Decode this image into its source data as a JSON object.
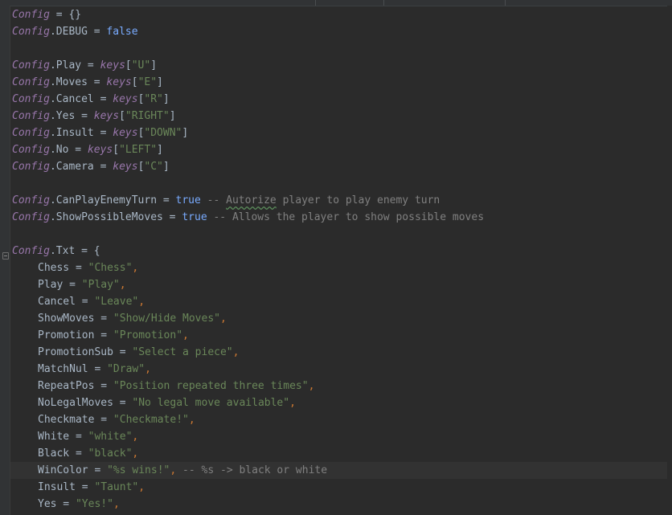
{
  "editor": {
    "top_lines": [
      {
        "obj": "Config",
        "rest": " = {}"
      },
      {
        "obj": "Config",
        "rest": ".DEBUG = ",
        "val": "false"
      }
    ],
    "keys": [
      {
        "obj": "Config",
        "field": ".Play = ",
        "fn": "keys",
        "open": "[",
        "str": "\"U\"",
        "close": "]"
      },
      {
        "obj": "Config",
        "field": ".Moves = ",
        "fn": "keys",
        "open": "[",
        "str": "\"E\"",
        "close": "]"
      },
      {
        "obj": "Config",
        "field": ".Cancel = ",
        "fn": "keys",
        "open": "[",
        "str": "\"R\"",
        "close": "]"
      },
      {
        "obj": "Config",
        "field": ".Yes = ",
        "fn": "keys",
        "open": "[",
        "str": "\"RIGHT\"",
        "close": "]"
      },
      {
        "obj": "Config",
        "field": ".Insult = ",
        "fn": "keys",
        "open": "[",
        "str": "\"DOWN\"",
        "close": "]"
      },
      {
        "obj": "Config",
        "field": ".No = ",
        "fn": "keys",
        "open": "[",
        "str": "\"LEFT\"",
        "close": "]"
      },
      {
        "obj": "Config",
        "field": ".Camera = ",
        "fn": "keys",
        "open": "[",
        "str": "\"C\"",
        "close": "]"
      }
    ],
    "flags": [
      {
        "obj": "Config",
        "field": ".CanPlayEnemyTurn = ",
        "val": "true",
        "cmt_pre": " -- ",
        "cmt_word": "Autorize",
        "cmt_post": " player to play enemy turn"
      },
      {
        "obj": "Config",
        "field": ".ShowPossibleMoves = ",
        "val": "true",
        "cmt_pre": " -- ",
        "cmt_word": "",
        "cmt_post": "Allows the player to show possible moves"
      }
    ],
    "txt_open": {
      "obj": "Config",
      "rest": ".Txt = {"
    },
    "txt": [
      {
        "key": "Chess = ",
        "str": "\"Chess\"",
        "tail": ","
      },
      {
        "key": "Play = ",
        "str": "\"Play\"",
        "tail": ","
      },
      {
        "key": "Cancel = ",
        "str": "\"Leave\"",
        "tail": ","
      },
      {
        "key": "ShowMoves = ",
        "str": "\"Show/Hide Moves\"",
        "tail": ","
      },
      {
        "key": "Promotion = ",
        "str": "\"Promotion\"",
        "tail": ","
      },
      {
        "key": "PromotionSub = ",
        "str": "\"Select a piece\"",
        "tail": ","
      },
      {
        "key": "MatchNul = ",
        "str": "\"Draw\"",
        "tail": ","
      },
      {
        "key": "RepeatPos = ",
        "str": "\"Position repeated three times\"",
        "tail": ","
      },
      {
        "key": "NoLegalMoves = ",
        "str": "\"No legal move available\"",
        "tail": ","
      },
      {
        "key": "Checkmate = ",
        "str": "\"Checkmate!\"",
        "tail": ","
      },
      {
        "key": "White = ",
        "str": "\"white\"",
        "tail": ","
      },
      {
        "key": "Black = ",
        "str": "\"black\"",
        "tail": ","
      },
      {
        "key": "WinColor = ",
        "str": "\"%s wins!\"",
        "tail": ",",
        "cmt": " -- %s -> black or white"
      },
      {
        "key": "Insult = ",
        "str": "\"Taunt\"",
        "tail": ","
      },
      {
        "key": "Yes = ",
        "str": "\"Yes!\"",
        "tail": ","
      }
    ]
  }
}
